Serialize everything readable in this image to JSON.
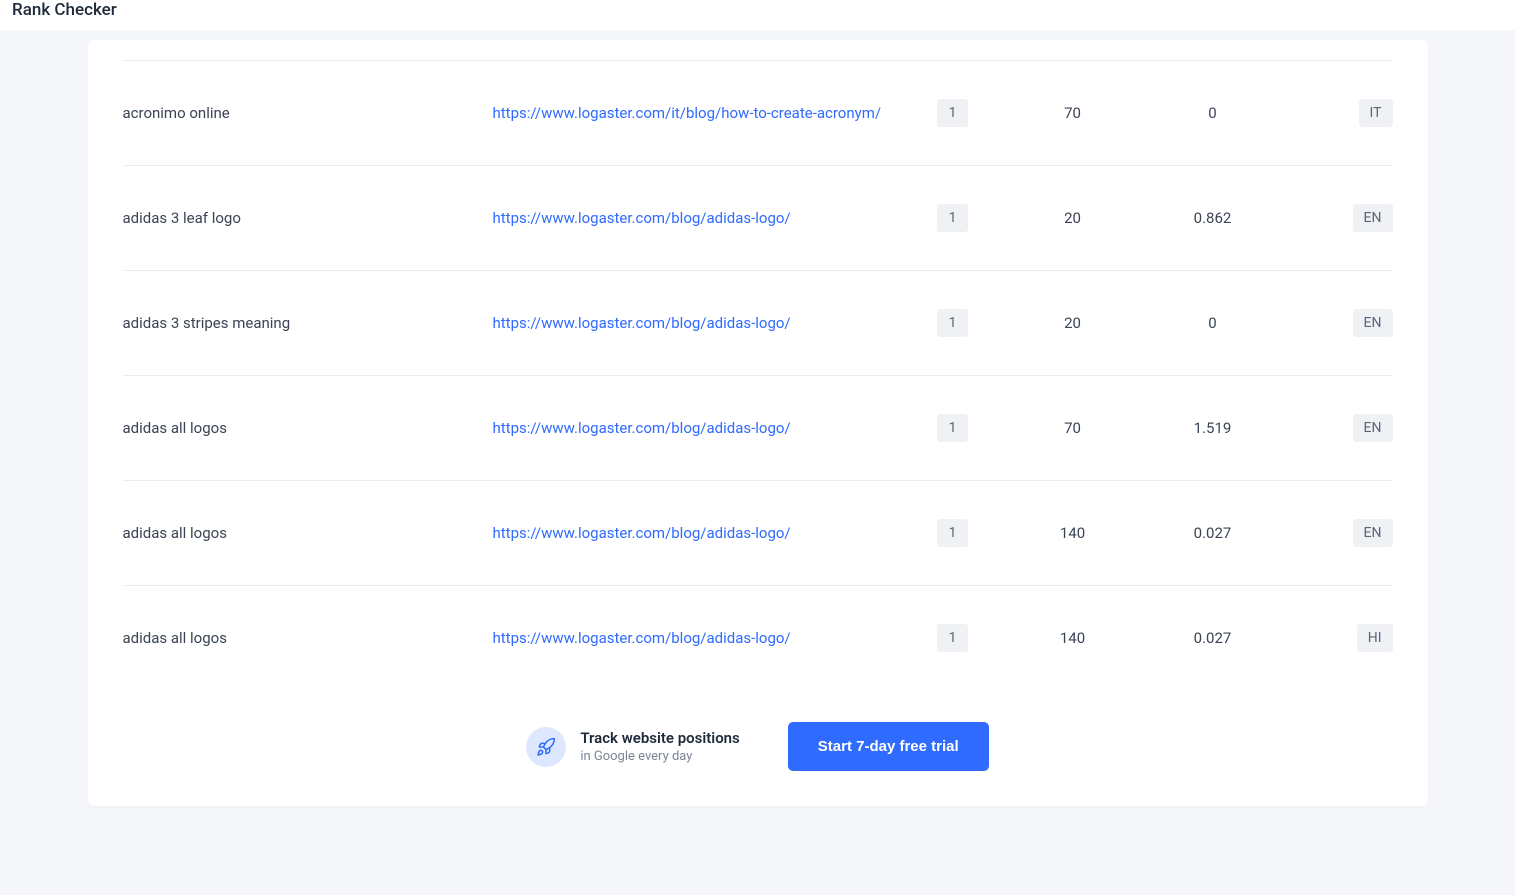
{
  "header": {
    "title": "Rank Checker"
  },
  "table": {
    "rows": [
      {
        "keyword": "acronimo online",
        "url": "https://www.logaster.com/it/blog/how-to-create-acronym/",
        "rank": "1",
        "volume": "70",
        "cpc": "0",
        "lang": "IT"
      },
      {
        "keyword": "adidas 3 leaf logo",
        "url": "https://www.logaster.com/blog/adidas-logo/",
        "rank": "1",
        "volume": "20",
        "cpc": "0.862",
        "lang": "EN"
      },
      {
        "keyword": "adidas 3 stripes meaning",
        "url": "https://www.logaster.com/blog/adidas-logo/",
        "rank": "1",
        "volume": "20",
        "cpc": "0",
        "lang": "EN"
      },
      {
        "keyword": "adidas all logos",
        "url": "https://www.logaster.com/blog/adidas-logo/",
        "rank": "1",
        "volume": "70",
        "cpc": "1.519",
        "lang": "EN"
      },
      {
        "keyword": "adidas all logos",
        "url": "https://www.logaster.com/blog/adidas-logo/",
        "rank": "1",
        "volume": "140",
        "cpc": "0.027",
        "lang": "EN"
      },
      {
        "keyword": "adidas all logos",
        "url": "https://www.logaster.com/blog/adidas-logo/",
        "rank": "1",
        "volume": "140",
        "cpc": "0.027",
        "lang": "HI"
      }
    ]
  },
  "cta": {
    "title": "Track website positions",
    "subtitle": "in Google every day",
    "button": "Start 7-day free trial"
  }
}
